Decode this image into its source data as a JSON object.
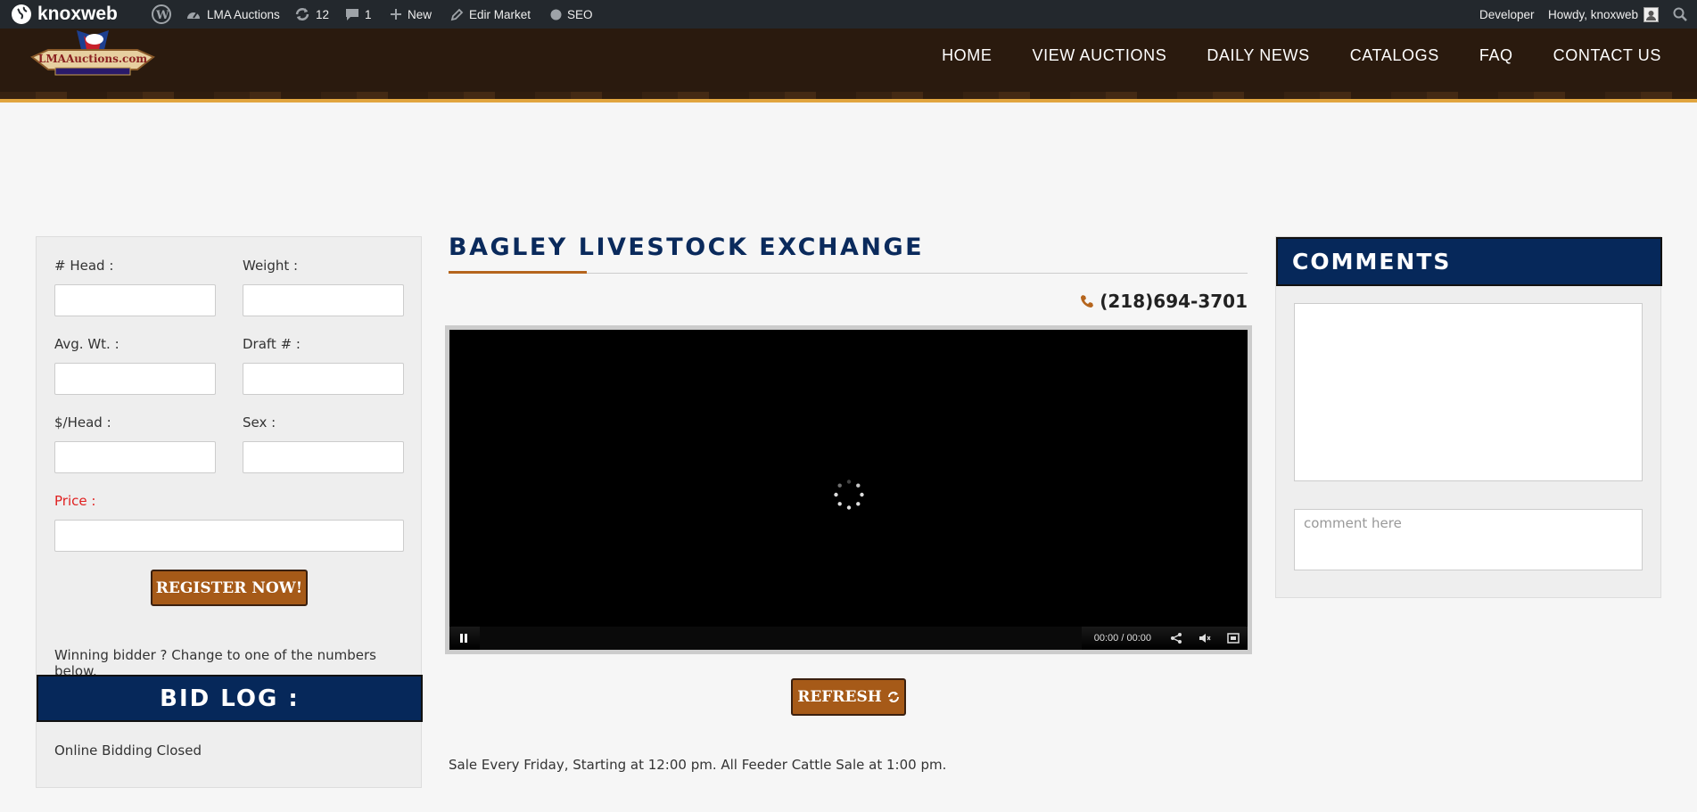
{
  "adminbar": {
    "brand": "knoxweb",
    "site_name": "LMA Auctions",
    "updates_count": "12",
    "comments_count": "1",
    "new_label": "New",
    "edit_label": "Edir Market",
    "seo_label": "SEO",
    "developer_label": "Developer",
    "howdy_label": "Howdy, knoxweb"
  },
  "header": {
    "logo_text": "LMAAuctions.com",
    "nav": [
      "HOME",
      "VIEW AUCTIONS",
      "DAILY NEWS",
      "CATALOGS",
      "FAQ",
      "CONTACT US"
    ]
  },
  "form": {
    "head_label": "# Head :",
    "weight_label": "Weight :",
    "avg_wt_label": "Avg. Wt. :",
    "draft_label": "Draft # :",
    "per_head_label": "$/Head :",
    "sex_label": "Sex :",
    "price_label": "Price :",
    "register_button": "REGISTER NOW!",
    "winning_text": "Winning bidder ? Change to one of the numbers below.",
    "bidlog_title": "BID LOG :",
    "bidlog_status": "Online Bidding Closed"
  },
  "main": {
    "title": "BAGLEY LIVESTOCK EXCHANGE",
    "phone": "(218)694-3701",
    "player_time": "00:00 / 00:00",
    "refresh_button": "REFRESH",
    "sale_text": "Sale Every Friday, Starting at 12:00 pm. All Feeder Cattle Sale at 1:00 pm."
  },
  "comments": {
    "title": "COMMENTS",
    "input_placeholder": "comment here"
  },
  "colors": {
    "navy": "#06285a",
    "brown_button": "#a65a18",
    "header_bg": "#2a1a0e",
    "accent_gold": "#e1a53f"
  }
}
